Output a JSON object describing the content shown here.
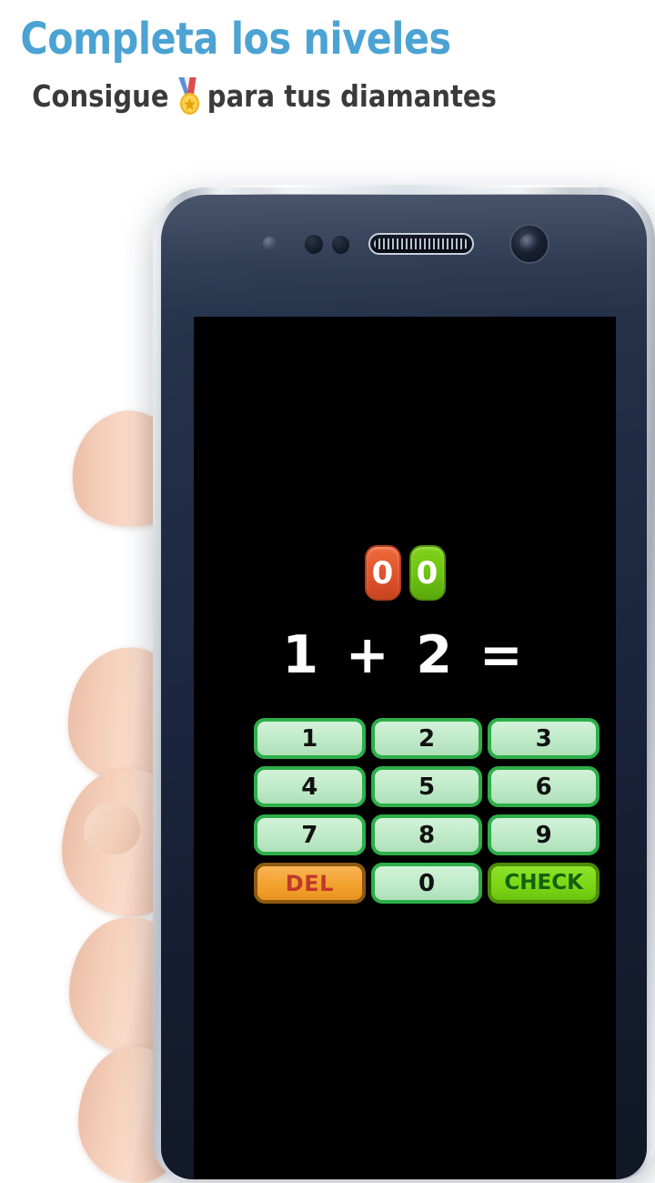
{
  "header": {
    "headline": "Completa los niveles",
    "subtitle_before": "Consigue",
    "medal_icon": "sports-medal-icon",
    "subtitle_after": "para tus diamantes",
    "headline_color": "#4BA3D3",
    "subtitle_color": "#3A3A3A"
  },
  "device": {
    "type": "android-smartphone",
    "bezel_color": "#1C2740",
    "frame_color": "#CDD3DA",
    "screen_background": "#000000",
    "sensors": [
      "light-sensor-icon",
      "proximity-sensor-icon",
      "proximity-sensor-icon"
    ],
    "earpiece": "earpiece-speaker-icon",
    "front_camera": "front-camera-icon"
  },
  "game": {
    "score_badges": [
      {
        "value": "0",
        "color": "#E0522A",
        "kind": "wrong-count"
      },
      {
        "value": "0",
        "color": "#6CC211",
        "kind": "correct-count"
      }
    ],
    "equation": "1 + 2 =",
    "operands": [
      1,
      2
    ],
    "operator": "+",
    "answer_field": "",
    "keypad": {
      "rows": [
        [
          {
            "label": "1",
            "kind": "num"
          },
          {
            "label": "2",
            "kind": "num"
          },
          {
            "label": "3",
            "kind": "num"
          }
        ],
        [
          {
            "label": "4",
            "kind": "num"
          },
          {
            "label": "5",
            "kind": "num"
          },
          {
            "label": "6",
            "kind": "num"
          }
        ],
        [
          {
            "label": "7",
            "kind": "num"
          },
          {
            "label": "8",
            "kind": "num"
          },
          {
            "label": "9",
            "kind": "num"
          }
        ],
        [
          {
            "label": "DEL",
            "kind": "del"
          },
          {
            "label": "0",
            "kind": "num"
          },
          {
            "label": "CHECK",
            "kind": "check"
          }
        ]
      ],
      "num_fill": "#BFEAC8",
      "num_border": "#2DAE49",
      "del_fill": "#F4A22F",
      "del_text": "#C0392B",
      "check_fill": "#7CD717",
      "check_text": "#14610D"
    }
  }
}
